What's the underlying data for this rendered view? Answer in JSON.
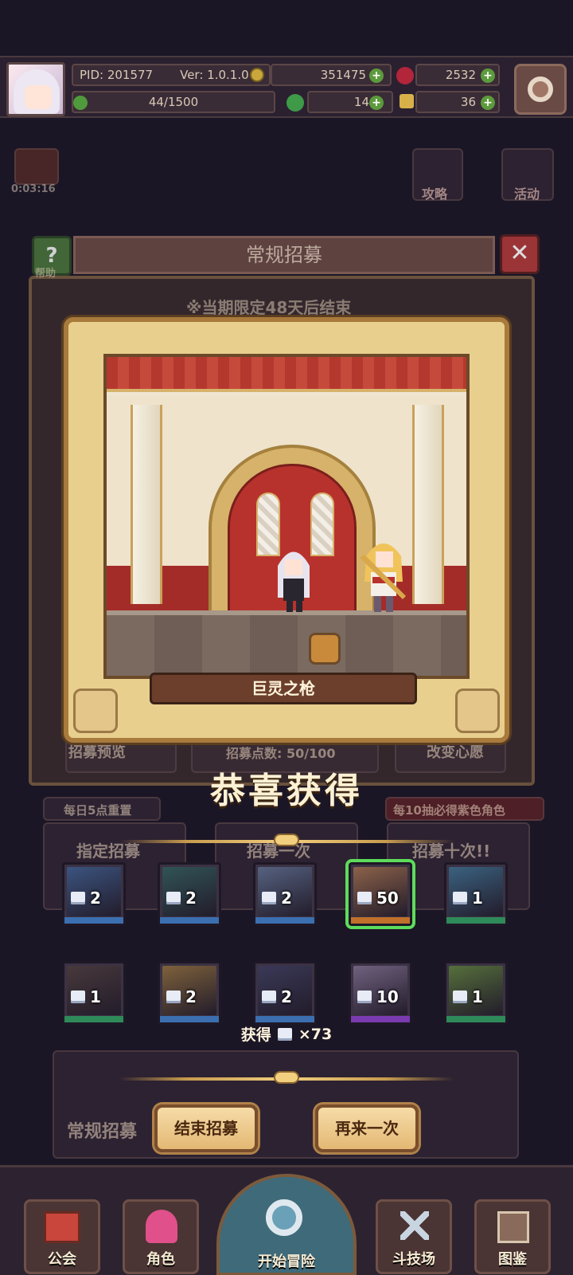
{
  "topbar": {
    "pid": "PID: 201577",
    "version": "Ver: 1.0.1.0",
    "gold": "351475",
    "gems": "2532",
    "stamina": "44/1500",
    "clovers": "14",
    "keys": "36"
  },
  "background": {
    "timer": "0:03:16",
    "guide_label": "攻略",
    "event_label": "活动",
    "notice": "※当期限定48天后结束",
    "preview_label": "招募预览",
    "points_label": "招募点数: 50/100",
    "wish_label": "改变心愿",
    "daily_reset": "每日5点重置",
    "pity_note": "每10抽必得紫色角色",
    "targeted_label": "指定招募",
    "once_label": "招募一次",
    "ten_label": "招募十次!!",
    "bottom_banner": "常规招募"
  },
  "panel": {
    "title": "常规招募",
    "help": "帮助",
    "close": "✕"
  },
  "reveal": {
    "item_name": "巨灵之枪"
  },
  "congrats": "恭喜获得",
  "rewards": [
    {
      "count": "2",
      "color": "#3b5a8a",
      "bar": "#3b6fb0"
    },
    {
      "count": "2",
      "color": "#2f5a5a",
      "bar": "#3b6fb0"
    },
    {
      "count": "2",
      "color": "#5a6a8a",
      "bar": "#3b6fb0"
    },
    {
      "count": "50",
      "color": "#9a6a4a",
      "bar": "#c0702a",
      "selected": true
    },
    {
      "count": "1",
      "color": "#3a6a8a",
      "bar": "#2f8a5a"
    },
    {
      "count": "1",
      "color": "#4a3a3a",
      "bar": "#2f8a5a"
    },
    {
      "count": "2",
      "color": "#8a6a3a",
      "bar": "#3b6fb0"
    },
    {
      "count": "2",
      "color": "#3a3a5a",
      "bar": "#3b6fb0"
    },
    {
      "count": "10",
      "color": "#7a6a8a",
      "bar": "#7a3ab0"
    },
    {
      "count": "1",
      "color": "#5a7a3a",
      "bar": "#2f8a5a"
    }
  ],
  "total": {
    "prefix": "获得",
    "amount": "×73"
  },
  "buttons": {
    "end": "结束招募",
    "again": "再来一次"
  },
  "nav": {
    "guild": "公会",
    "character": "角色",
    "adventure": "开始冒险",
    "arena": "斗技场",
    "codex": "图鉴"
  }
}
